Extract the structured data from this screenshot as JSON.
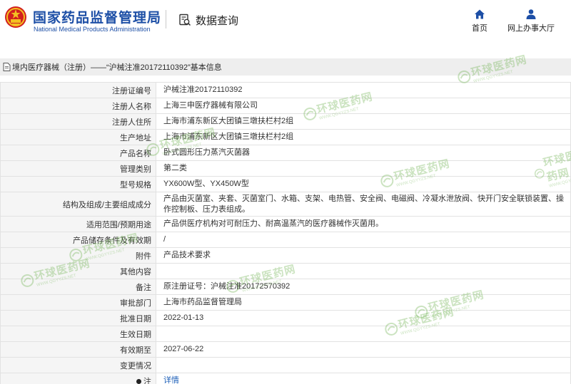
{
  "header": {
    "org_name_cn": "国家药品监督管理局",
    "org_name_en": "National Medical Products Administration",
    "query_label": "数据查询",
    "nav": [
      {
        "label": "首页",
        "icon": "home-icon"
      },
      {
        "label": "网上办事大厅",
        "icon": "person-icon"
      }
    ],
    "colors": {
      "brand": "#1d4fa6",
      "emblem_red": "#d2201f",
      "emblem_gold": "#f3c021"
    }
  },
  "breadcrumb": {
    "icon": "document-icon",
    "text": "境内医疗器械（注册）——“沪械注准20172110392”基本信息"
  },
  "info_rows": [
    {
      "label": "注册证编号",
      "value": "沪械注准20172110392"
    },
    {
      "label": "注册人名称",
      "value": "上海三申医疗器械有限公司"
    },
    {
      "label": "注册人住所",
      "value": "上海市浦东新区大团镇三墩扶栏村2组"
    },
    {
      "label": "生产地址",
      "value": "上海市浦东新区大团镇三墩扶栏村2组"
    },
    {
      "label": "产品名称",
      "value": "卧式圆形压力蒸汽灭菌器"
    },
    {
      "label": "管理类别",
      "value": "第二类"
    },
    {
      "label": "型号规格",
      "value": "YX600W型、YX450W型"
    },
    {
      "label": "结构及组成/主要组成成分",
      "value": "产品由灭菌室、夹套、灭菌室门、水箱、支架、电热管、安全阀、电磁阀、冷凝水泄放阀、快开门安全联锁装置、操作控制板、压力表组成。"
    },
    {
      "label": "适用范围/预期用途",
      "value": "产品供医疗机构对可耐压力、耐高温蒸汽的医疗器械作灭菌用。"
    },
    {
      "label": "产品储存条件及有效期",
      "value": "/"
    },
    {
      "label": "附件",
      "value": "产品技术要求"
    },
    {
      "label": "其他内容",
      "value": ""
    },
    {
      "label": "备注",
      "value": "原注册证号：沪械注准20172570392"
    },
    {
      "label": "审批部门",
      "value": "上海市药品监督管理局"
    },
    {
      "label": "批准日期",
      "value": "2022-01-13"
    },
    {
      "label": "生效日期",
      "value": ""
    },
    {
      "label": "有效期至",
      "value": "2027-06-22"
    },
    {
      "label": "变更情况",
      "value": ""
    },
    {
      "label": "注",
      "value": "详情"
    }
  ],
  "watermark": {
    "cn": "环球医药网",
    "en": "WWW.QGYYZS.NET",
    "color": "#6db24e"
  }
}
